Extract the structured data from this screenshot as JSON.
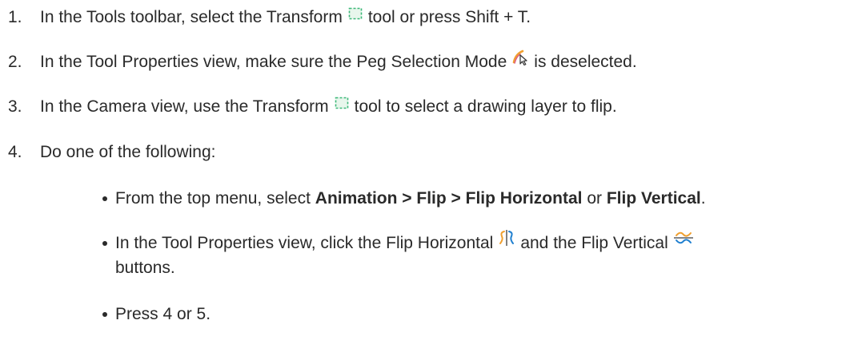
{
  "steps": [
    {
      "number": "1.",
      "before": "In the Tools toolbar, select the Transform",
      "icon": "transform-tool-icon",
      "after": "tool or press Shift + T."
    },
    {
      "number": "2.",
      "before": "In the Tool Properties view, make sure the Peg Selection Mode",
      "icon": "peg-selection-mode-icon",
      "after": "is deselected."
    },
    {
      "number": "3.",
      "before": "In the Camera view, use the Transform",
      "icon": "transform-tool-icon",
      "after": "tool to select a drawing layer to flip."
    },
    {
      "number": "4.",
      "text": "Do one of the following:"
    }
  ],
  "bullets": {
    "menu": {
      "before": "From the top menu, select",
      "path": "Animation > Flip > Flip Horizontal",
      "or": "or",
      "alt": "Flip Vertical",
      "end": "."
    },
    "properties": {
      "before": "In the Tool Properties view, click the Flip Horizontal",
      "icon1": "flip-horizontal-icon",
      "middle": "and the Flip Vertical",
      "icon2": "flip-vertical-icon",
      "continuation": "buttons."
    },
    "press": {
      "text": "Press 4 or 5."
    }
  },
  "colors": {
    "text": "#2a2a2a",
    "icon_orange": "#f0a030",
    "icon_green": "#3cb878",
    "icon_blue": "#2080d0",
    "icon_dark": "#303030"
  }
}
